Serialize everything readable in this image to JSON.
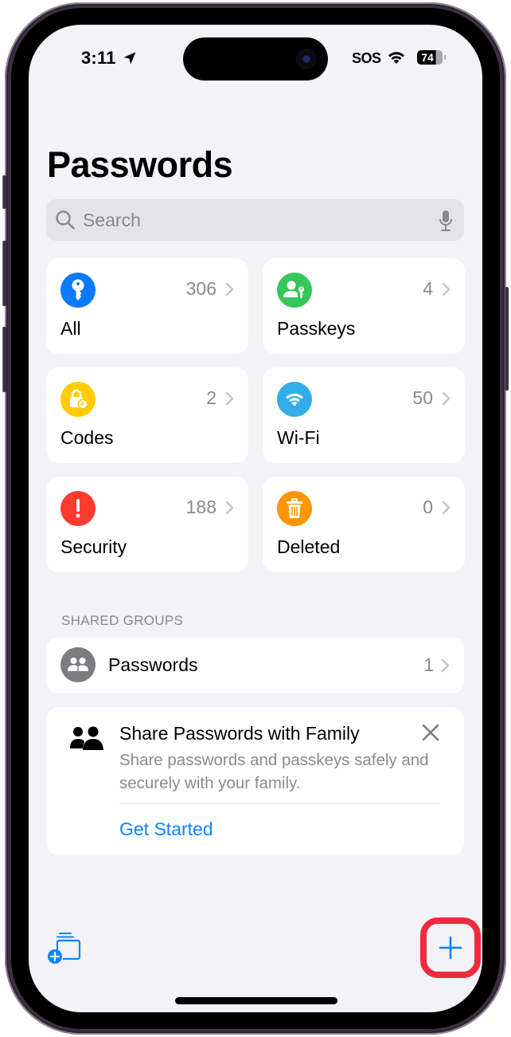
{
  "status_bar": {
    "time": "3:11",
    "carrier": "SOS",
    "battery_percent": "74"
  },
  "header": {
    "title": "Passwords"
  },
  "search": {
    "placeholder": "Search",
    "value": ""
  },
  "categories": [
    {
      "label": "All",
      "count": "306",
      "icon": "key-icon",
      "color": "#0a7aff"
    },
    {
      "label": "Passkeys",
      "count": "4",
      "icon": "person-key-icon",
      "color": "#34c759"
    },
    {
      "label": "Codes",
      "count": "2",
      "icon": "lock-clock-icon",
      "color": "#ffcc00"
    },
    {
      "label": "Wi-Fi",
      "count": "50",
      "icon": "wifi-icon",
      "color": "#32ade6"
    },
    {
      "label": "Security",
      "count": "188",
      "icon": "exclamation-icon",
      "color": "#ff3b30"
    },
    {
      "label": "Deleted",
      "count": "0",
      "icon": "trash-icon",
      "color": "#ff9500"
    }
  ],
  "shared_groups": {
    "header": "SHARED GROUPS",
    "items": [
      {
        "label": "Passwords",
        "count": "1",
        "icon": "people-icon"
      }
    ]
  },
  "family_card": {
    "title": "Share Passwords with Family",
    "description": "Share passwords and passkeys safely and securely with your family.",
    "action_label": "Get Started",
    "icon": "family-icon"
  },
  "toolbar": {
    "new_group_icon": "new-shared-group-icon",
    "add_icon": "plus-icon",
    "highlight_color": "#ee2a3e",
    "accent_color": "#0a84ff"
  }
}
